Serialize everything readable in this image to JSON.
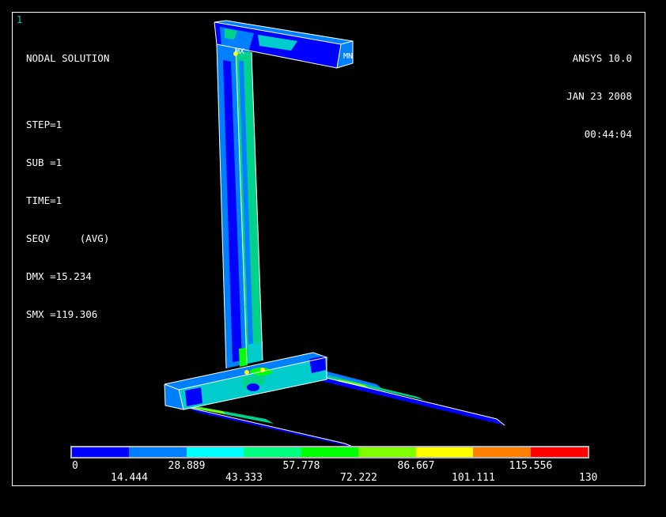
{
  "window_number": "1",
  "info_lines": [
    "NODAL SOLUTION",
    "STEP=1",
    "SUB =1",
    "TIME=1",
    "SEQV     (AVG)",
    "DMX =15.234",
    "SMX =119.306"
  ],
  "stamp": {
    "product": "ANSYS 10.0",
    "date": "JAN 23 2008",
    "time": "00:44:04"
  },
  "markers": {
    "max": "MX",
    "min": "MN"
  },
  "legend": {
    "colors": [
      "#0000ff",
      "#0080ff",
      "#00ffff",
      "#00ff80",
      "#00ff00",
      "#80ff00",
      "#ffff00",
      "#ff8000",
      "#ff0000"
    ],
    "labels_top": [
      "0",
      "28.889",
      "57.778",
      "86.667",
      "115.556"
    ],
    "labels_bottom": [
      "14.444",
      "43.333",
      "72.222",
      "101.111",
      "130"
    ]
  },
  "contour_colors": {
    "low": "#0000ff",
    "light": "#0080ff",
    "cyan": "#00cccc",
    "mid": "#00d28c",
    "green": "#00ff00",
    "yellow": "#ffff00"
  }
}
